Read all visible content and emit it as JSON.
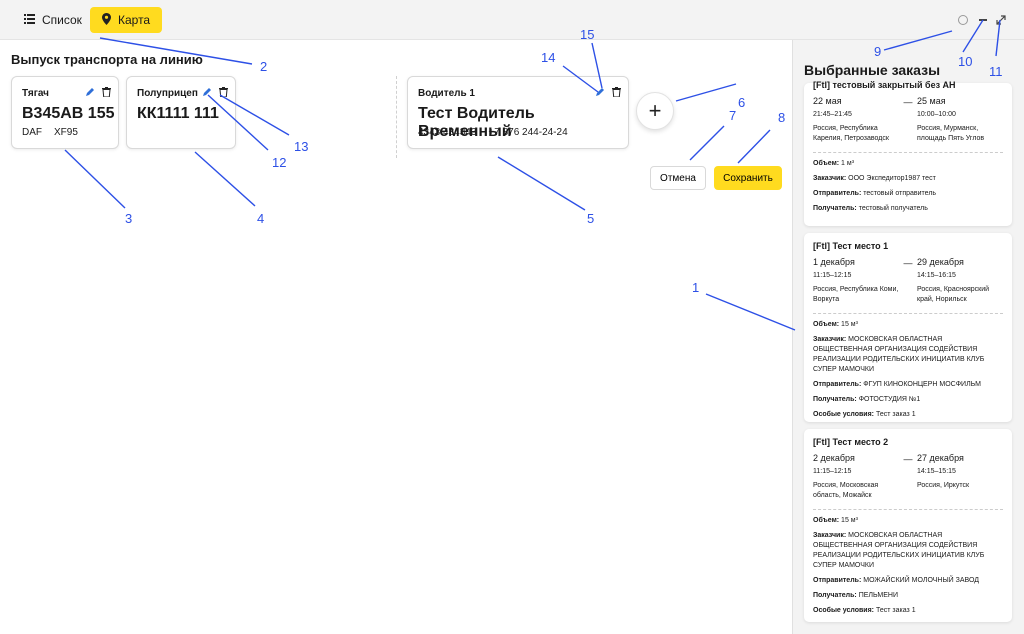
{
  "tabs": [
    {
      "label": "Список",
      "icon": "list-icon"
    },
    {
      "label": "Карта",
      "icon": "map-pin-icon",
      "active": true
    }
  ],
  "main": {
    "title": "Выпуск транспорта на линию",
    "tractor": {
      "label": "Тягач",
      "plate": "В345АВ 155",
      "brand": "DAF",
      "model": "XF95"
    },
    "trailer": {
      "label": "Полуприцеп",
      "plate": "КК1111 111"
    },
    "driver": {
      "label": "Водитель 1",
      "name": "Тест Водитель Временный",
      "id": "4343 434343",
      "phone": "+7 876 244-24-24"
    },
    "cancel_label": "Отмена",
    "save_label": "Сохранить"
  },
  "panel": {
    "title": "Выбранные заказы",
    "orders": [
      {
        "title": "[Ftl] тестовый закрытый без АН",
        "from": {
          "date": "22 мая",
          "time": "21:45–21:45",
          "place": "Россия, Республика Карелия, Петрозаводск"
        },
        "to": {
          "date": "25 мая",
          "time": "10:00–10:00",
          "place": "Россия, Мурманск, площадь Пять Углов"
        },
        "volume_label": "Объем:",
        "volume": "1 м³",
        "customer_label": "Заказчик:",
        "customer": "ООО Экспедитор1987 тест",
        "sender_label": "Отправитель:",
        "sender": "тестовый отправитель",
        "receiver_label": "Получатель:",
        "receiver": "тестовый получатель"
      },
      {
        "title": "[Ftl] Тест место 1",
        "from": {
          "date": "1 декабря",
          "time": "11:15–12:15",
          "place": "Россия, Республика Коми, Воркута"
        },
        "to": {
          "date": "29 декабря",
          "time": "14:15–16:15",
          "place": "Россия, Красноярский край, Норильск"
        },
        "volume_label": "Объем:",
        "volume": "15 м³",
        "customer_label": "Заказчик:",
        "customer": "МОСКОВСКАЯ ОБЛАСТНАЯ ОБЩЕСТВЕННАЯ ОРГАНИЗАЦИЯ СОДЕЙСТВИЯ РЕАЛИЗАЦИИ РОДИТЕЛЬСКИХ ИНИЦИАТИВ КЛУБ СУПЕР МАМОЧКИ",
        "sender_label": "Отправитель:",
        "sender": "ФГУП КИНОКОНЦЕРН МОСФИЛЬМ",
        "receiver_label": "Получатель:",
        "receiver": "ФОТОСТУДИЯ №1",
        "conditions_label": "Особые условия:",
        "conditions": "Тест заказ 1"
      },
      {
        "title": "[Ftl] Тест место 2",
        "from": {
          "date": "2 декабря",
          "time": "11:15–12:15",
          "place": "Россия, Московская область, Можайск"
        },
        "to": {
          "date": "27 декабря",
          "time": "14:15–15:15",
          "place": "Россия, Иркутск"
        },
        "volume_label": "Объем:",
        "volume": "15 м³",
        "customer_label": "Заказчик:",
        "customer": "МОСКОВСКАЯ ОБЛАСТНАЯ ОБЩЕСТВЕННАЯ ОРГАНИЗАЦИЯ СОДЕЙСТВИЯ РЕАЛИЗАЦИИ РОДИТЕЛЬСКИХ ИНИЦИАТИВ КЛУБ СУПЕР МАМОЧКИ",
        "sender_label": "Отправитель:",
        "sender": "МОЖАЙСКИЙ МОЛОЧНЫЙ ЗАВОД",
        "receiver_label": "Получатель:",
        "receiver": "ПЕЛЬМЕНИ",
        "conditions_label": "Особые условия:",
        "conditions": "Тест заказ 1"
      }
    ]
  },
  "annotations": {
    "n1": "1",
    "n2": "2",
    "n3": "3",
    "n4": "4",
    "n5": "5",
    "n6": "6",
    "n7": "7",
    "n8": "8",
    "n9": "9",
    "n10": "10",
    "n11": "11",
    "n12": "12",
    "n13": "13",
    "n14": "14",
    "n15": "15"
  },
  "colors": {
    "accent": "#ffdb1f",
    "annotation": "#2d50e6",
    "panel_bg": "#f3f3f3"
  }
}
